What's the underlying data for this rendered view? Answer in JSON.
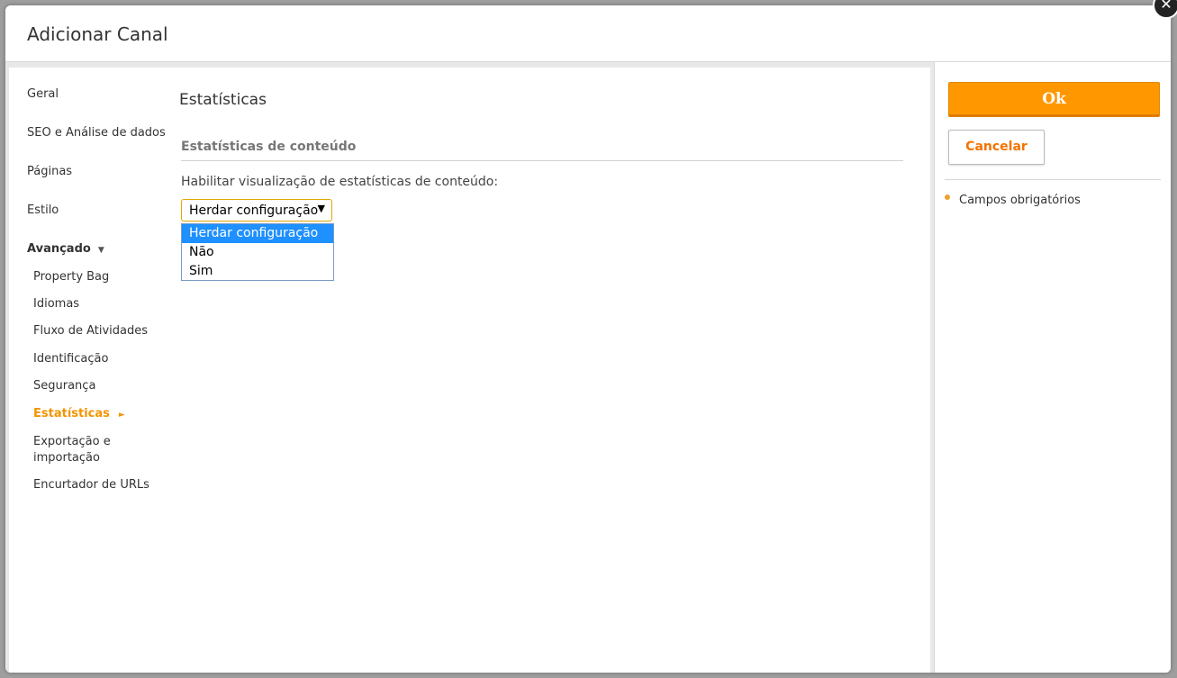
{
  "dialog": {
    "title": "Adicionar Canal",
    "close_symbol": "✕"
  },
  "sidebar": {
    "items": [
      {
        "label": "Geral"
      },
      {
        "label": "SEO e Análise de dados"
      },
      {
        "label": "Páginas"
      },
      {
        "label": "Estilo"
      }
    ],
    "advanced": {
      "label": "Avançado",
      "caret": "▼",
      "subitems": [
        {
          "label": "Property Bag"
        },
        {
          "label": "Idiomas"
        },
        {
          "label": "Fluxo de Atividades"
        },
        {
          "label": "Identificação"
        },
        {
          "label": "Segurança"
        },
        {
          "label": "Estatísticas",
          "active": true
        },
        {
          "label": "Exportação e importação"
        },
        {
          "label": "Encurtador de URLs"
        }
      ],
      "active_arrow": "►"
    }
  },
  "main": {
    "section_title": "Estatísticas",
    "subsection_title": "Estatísticas de conteúdo",
    "field_label": "Habilitar visualização de estatísticas de conteúdo:",
    "select": {
      "value": "Herdar configuração",
      "arrow": "▼",
      "options": [
        "Herdar configuração",
        "Não",
        "Sim"
      ],
      "highlighted_index": 0
    }
  },
  "actions": {
    "ok_label": "Ok",
    "cancel_label": "Cancelar",
    "required_note": "Campos obrigatórios"
  },
  "colors": {
    "accent": "#ff9800",
    "active_nav": "#f29400",
    "cancel_text": "#f27300",
    "dropdown_highlight": "#1e90ff",
    "select_border": "#e0a800",
    "required_bullet": "#f0a030"
  },
  "icons": {
    "close": "close-icon",
    "caret_down": "caret-down-icon",
    "arrow_right": "arrow-right-icon",
    "select_arrow": "dropdown-arrow-icon",
    "bullet": "bullet-icon"
  }
}
